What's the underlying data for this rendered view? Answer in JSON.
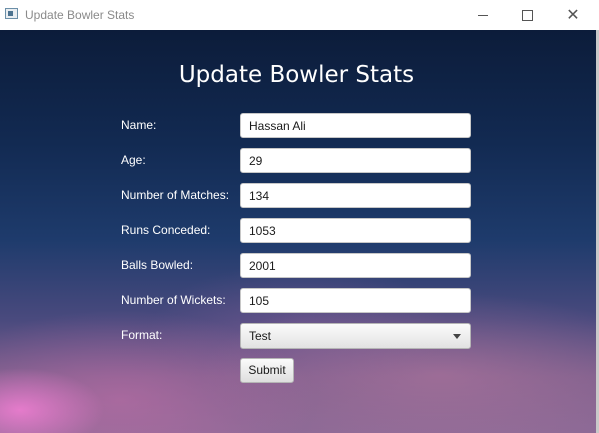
{
  "window": {
    "title": "Update Bowler Stats",
    "minimize_icon": "minimize-icon",
    "maximize_icon": "maximize-icon",
    "close_icon": "close-icon",
    "close_glyph": "✕"
  },
  "form": {
    "heading": "Update Bowler Stats",
    "fields": {
      "name": {
        "label": "Name:",
        "value": "Hassan Ali"
      },
      "age": {
        "label": "Age:",
        "value": "29"
      },
      "matches": {
        "label": "Number of Matches:",
        "value": "134"
      },
      "runs": {
        "label": "Runs Conceded:",
        "value": "1053"
      },
      "balls": {
        "label": "Balls Bowled:",
        "value": "2001"
      },
      "wickets": {
        "label": "Number of Wickets:",
        "value": "105"
      },
      "format": {
        "label": "Format:",
        "value": "Test"
      }
    },
    "submit_label": "Submit"
  },
  "colors": {
    "background_top": "#0c1c3a",
    "background_bottom": "#8c6a96",
    "label_text": "#ffffff"
  }
}
